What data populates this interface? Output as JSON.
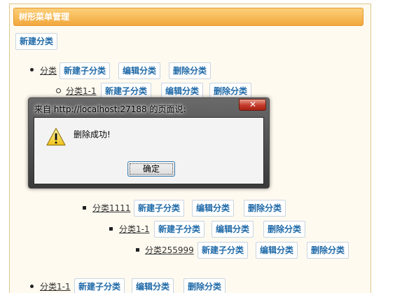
{
  "panel": {
    "title": "树形菜单管理",
    "new_category_button": "新建分类"
  },
  "actions": {
    "new_child": "新建子分类",
    "edit": "编辑分类",
    "delete": "删除分类"
  },
  "tree": [
    {
      "label": "分类",
      "level": 0
    },
    {
      "label": "分类1-1",
      "level": 1
    },
    {
      "label": "分类1111",
      "level": 2
    },
    {
      "label": "分类1-1",
      "level": 3
    },
    {
      "label": "分类255999",
      "level": 4
    },
    {
      "label": "分类1-1",
      "level": 0
    }
  ],
  "dialog": {
    "title": "来自 http://localhost:27188 的页面说:",
    "message": "删除成功!",
    "ok_button": "确定",
    "close_glyph": "✕",
    "icon": "warning-icon"
  },
  "colors": {
    "header_orange": "#f2a73c",
    "button_text_blue": "#1f6aa8",
    "dialog_frame": "#4a4a4a",
    "close_red": "#c4392a"
  }
}
